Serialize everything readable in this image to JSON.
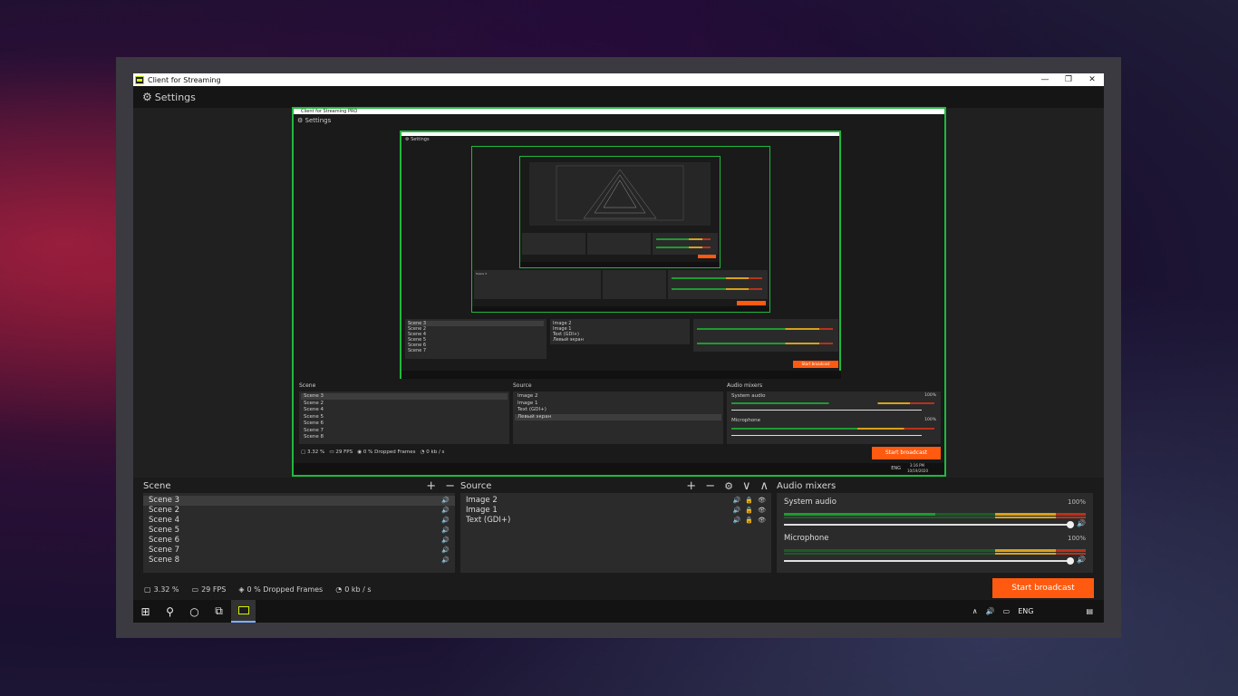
{
  "window": {
    "title": "Client for Streaming",
    "controls": [
      "—",
      "❐",
      "✕"
    ]
  },
  "settings": {
    "label": "Settings"
  },
  "nested_capture": {
    "title": "Client for Streaming PRO",
    "settings_label": "Settings",
    "scene_header": "Scene",
    "source_header": "Source",
    "mixer_header": "Audio mixers",
    "scenes": [
      "Scene 3",
      "Scene 2",
      "Scene 4",
      "Scene 5",
      "Scene 6",
      "Scene 7",
      "Scene 8"
    ],
    "sources": [
      "Image 2",
      "Image 1",
      "Text (GDI+)",
      "Левый экран"
    ],
    "mixer": [
      {
        "label": "System audio",
        "pct": "100%"
      },
      {
        "label": "Microphone",
        "pct": "100%"
      }
    ],
    "status": {
      "cpu": "3.32 %",
      "fps": "29 FPS",
      "dropped": "0 % Dropped Frames",
      "bitrate": "0 kb / s"
    },
    "start_label": "Start broadcast",
    "clock_time": "3:16 PM",
    "clock_date": "10/19/2020",
    "lang": "ENG"
  },
  "scene_panel": {
    "header": "Scene",
    "add": "+",
    "remove": "−",
    "items": [
      {
        "label": "Scene 3",
        "selected": true
      },
      {
        "label": "Scene 2",
        "selected": false
      },
      {
        "label": "Scene 4",
        "selected": false
      },
      {
        "label": "Scene 5",
        "selected": false
      },
      {
        "label": "Scene 6",
        "selected": false
      },
      {
        "label": "Scene 7",
        "selected": false
      },
      {
        "label": "Scene 8",
        "selected": false
      }
    ]
  },
  "source_panel": {
    "header": "Source",
    "add": "+",
    "remove": "−",
    "gear": "⚙",
    "down": "∨",
    "up": "∧",
    "items": [
      "Image 2",
      "Image 1",
      "Text (GDI+)"
    ]
  },
  "mixer_panel": {
    "header": "Audio mixers",
    "channels": [
      {
        "label": "System audio",
        "pct": "100%",
        "level": 1.0
      },
      {
        "label": "Microphone",
        "pct": "100%",
        "level": 1.0
      }
    ]
  },
  "status": {
    "cpu": "3.32 %",
    "fps": "29 FPS",
    "dropped": "0 % Dropped Frames",
    "bitrate": "0 kb / s"
  },
  "start_button": {
    "label": "Start broadcast"
  },
  "taskbar": {
    "lang": "ENG"
  },
  "colors": {
    "accent": "#ff5a10",
    "capture_border": "#1fb93c",
    "meter_green": "#1f9a32",
    "meter_yellow": "#d7a21b",
    "meter_red": "#b8321b"
  }
}
